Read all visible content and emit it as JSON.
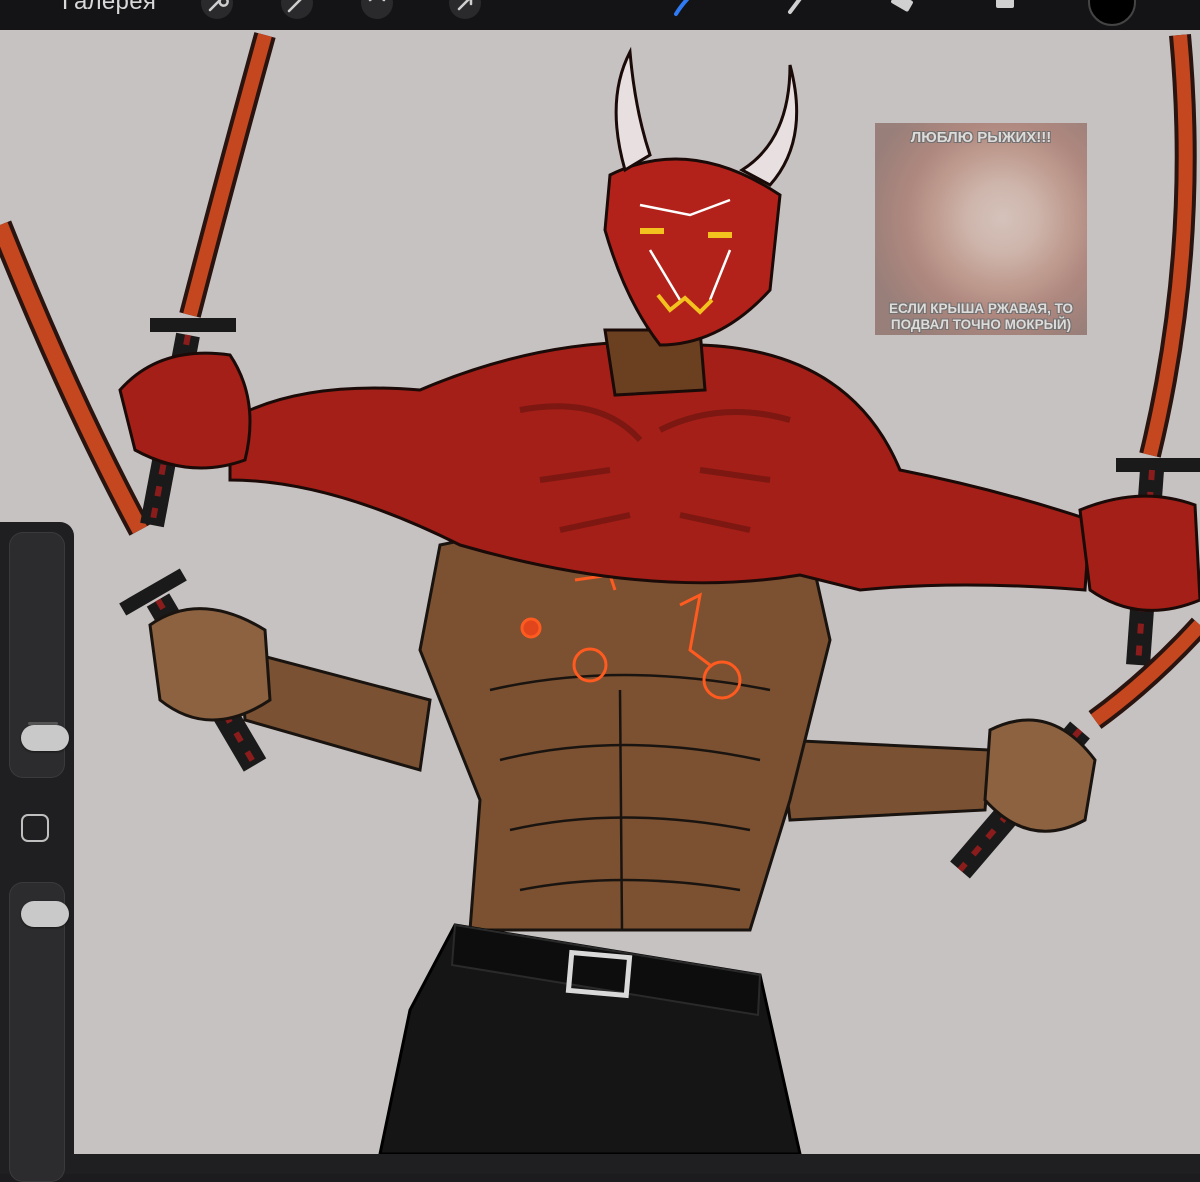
{
  "toolbar": {
    "gallery_label": "Галерея",
    "left_tools": [
      "wrench-icon",
      "magic-wand-icon",
      "selection-icon",
      "transform-arrow-icon"
    ],
    "right_tools": [
      "brush-icon",
      "smudge-icon",
      "eraser-icon",
      "layers-icon",
      "color-swatch"
    ],
    "active_tool": "brush-icon",
    "accent_color": "#2f7bf5",
    "current_color": "#000000"
  },
  "meme": {
    "top_text": "ЛЮБЛЮ РЫЖИХ!!!",
    "bottom_text_line1": "ЕСЛИ КРЫША РЖАВАЯ, ТО",
    "bottom_text_line2": "ПОДВАЛ ТОЧНО МОКРЫЙ)"
  },
  "sidebar": {
    "brush_size_level": 0.1,
    "brush_opacity_level": 0.95
  }
}
